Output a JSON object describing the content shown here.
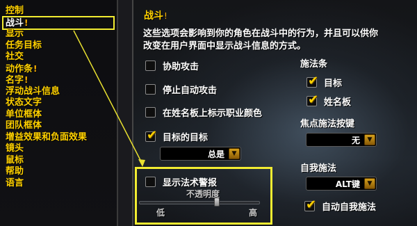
{
  "categories": [
    {
      "label": "控制",
      "warn": false,
      "selected": false
    },
    {
      "label": "战斗",
      "warn": true,
      "selected": true
    },
    {
      "label": "显示",
      "warn": false,
      "selected": false
    },
    {
      "label": "任务目标",
      "warn": false,
      "selected": false
    },
    {
      "label": "社交",
      "warn": false,
      "selected": false
    },
    {
      "label": "动作条",
      "warn": true,
      "selected": false
    },
    {
      "label": "名字",
      "warn": true,
      "selected": false
    },
    {
      "label": "浮动战斗信息",
      "warn": false,
      "selected": false
    },
    {
      "label": "状态文字",
      "warn": false,
      "selected": false
    },
    {
      "label": "单位框体",
      "warn": false,
      "selected": false
    },
    {
      "label": "团队框体",
      "warn": false,
      "selected": false
    },
    {
      "label": "增益效果和负面效果",
      "warn": false,
      "selected": false
    },
    {
      "label": "镜头",
      "warn": false,
      "selected": false
    },
    {
      "label": "鼠标",
      "warn": false,
      "selected": false
    },
    {
      "label": "帮助",
      "warn": false,
      "selected": false
    },
    {
      "label": "语言",
      "warn": false,
      "selected": false
    }
  ],
  "warn_glyph": "!",
  "panel": {
    "title": "战斗",
    "description": "这些选项会影响到你的角色在战斗中的行为，并且可以供你改变在用户界面中显示战斗信息的方式。"
  },
  "options": {
    "assist_attack": {
      "label": "协助攻击",
      "checked": false
    },
    "stop_auto_attack": {
      "label": "停止自动攻击",
      "checked": false
    },
    "nameplate_class_color": {
      "label": "在姓名板上标示职业颜色",
      "checked": false
    },
    "target_of_target": {
      "label": "目标的目标",
      "checked": true
    },
    "show_spell_alerts": {
      "label": "显示法术警报",
      "checked": false
    }
  },
  "target_of_target_dropdown": {
    "value": "总是"
  },
  "spell_alert_opacity": {
    "label": "不透明度",
    "low": "低",
    "high": "高",
    "level": 0.65
  },
  "cast_bars": {
    "label": "施法条",
    "target": {
      "label": "目标",
      "checked": true
    },
    "nameplate": {
      "label": "姓名板",
      "checked": true
    }
  },
  "focus_cast_key": {
    "label": "焦点施法按键",
    "value": "无"
  },
  "self_cast": {
    "label": "自我施法",
    "value": "ALT键"
  },
  "auto_self_cast": {
    "label": "自动自我施法",
    "checked": true
  },
  "check_glyph": "✔",
  "dropdown_glyph": "▼",
  "colors": {
    "gold": "#ffd100",
    "highlight": "#f2ec31"
  }
}
